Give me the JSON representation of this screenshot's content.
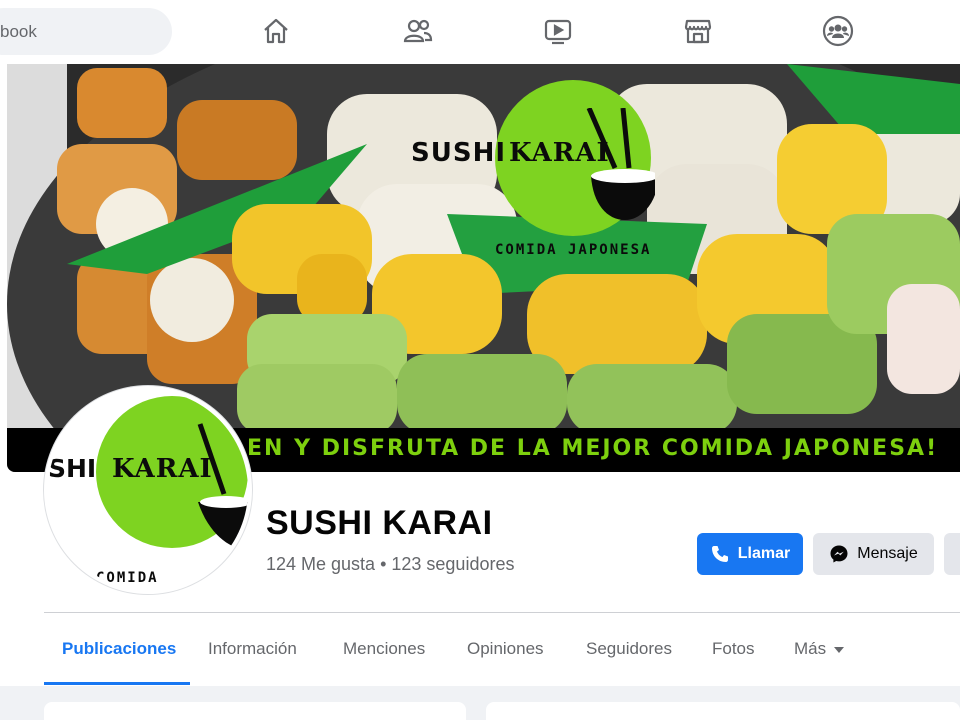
{
  "search": {
    "placeholder": "book"
  },
  "nav": {
    "icons": [
      "home-icon",
      "friends-icon",
      "watch-icon",
      "marketplace-icon",
      "groups-icon"
    ]
  },
  "cover": {
    "logo_word_a": "SUSHI",
    "logo_word_b": "KARAI",
    "logo_sub": "COMIDA JAPONESA",
    "banner_text": "EN Y DISFRUTA DE LA MEJOR COMIDA JAPONESA!",
    "logo_color": "#7ed321",
    "banner_color": "#7dd00e"
  },
  "avatar": {
    "word_a": "SHI",
    "word_b": "KARAI",
    "sub": "COMIDA"
  },
  "profile": {
    "name": "SUSHI KARAI",
    "stats": "124 Me gusta • 123 seguidores"
  },
  "actions": {
    "call_label": "Llamar",
    "message_label": "Mensaje"
  },
  "tabs": [
    {
      "label": "Publicaciones",
      "active": true
    },
    {
      "label": "Información",
      "active": false
    },
    {
      "label": "Menciones",
      "active": false
    },
    {
      "label": "Opiniones",
      "active": false
    },
    {
      "label": "Seguidores",
      "active": false
    },
    {
      "label": "Fotos",
      "active": false
    },
    {
      "label": "Más",
      "active": false
    }
  ],
  "colors": {
    "accent": "#1877f2",
    "muted_text": "#65676b",
    "button_secondary": "#e4e6eb"
  }
}
